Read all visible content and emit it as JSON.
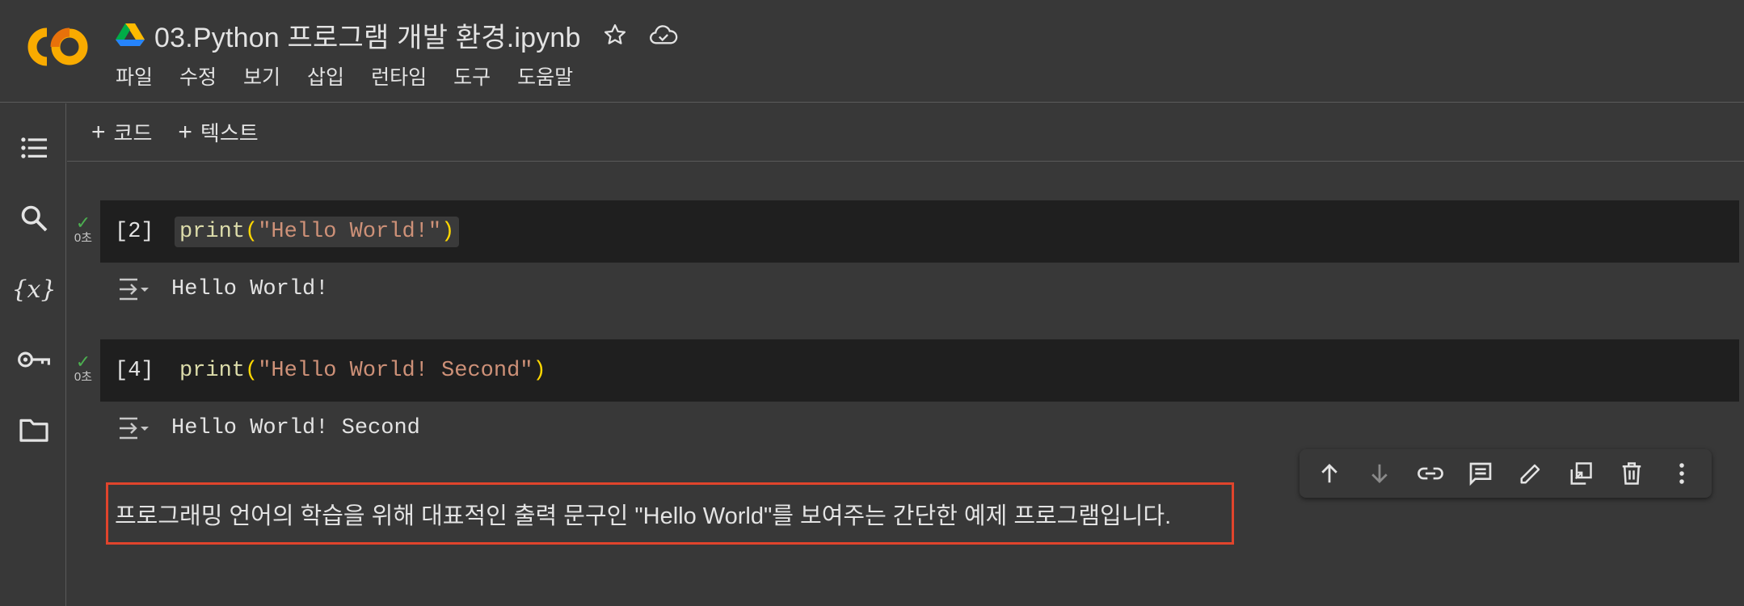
{
  "header": {
    "title": "03.Python 프로그램 개발 환경.ipynb",
    "menu": [
      "파일",
      "수정",
      "보기",
      "삽입",
      "런타임",
      "도구",
      "도움말"
    ]
  },
  "sidebar": {
    "icons": [
      "table-of-contents-icon",
      "search-icon",
      "variables-icon",
      "key-icon",
      "folder-icon"
    ],
    "variables_glyph": "{x}"
  },
  "toolbar": {
    "add_code_label": "코드",
    "add_text_label": "텍스트"
  },
  "cells": [
    {
      "status_time": "0초",
      "exec_count": "[2]",
      "code_fn": "print",
      "code_open": "(",
      "code_str": "\"Hello World!\"",
      "code_close": ")",
      "output": "Hello World!"
    },
    {
      "status_time": "0초",
      "exec_count": "[4]",
      "code_fn": "print",
      "code_open": "(",
      "code_str": "\"Hello World! Second\"",
      "code_close": ")",
      "output": "Hello World! Second"
    }
  ],
  "text_cell": {
    "content": "프로그래밍 언어의 학습을 위해 대표적인 출력 문구인 \"Hello World\"를 보여주는 간단한 예제 프로그램입니다."
  },
  "cell_toolbar": [
    "move-up-icon",
    "move-down-icon",
    "link-icon",
    "comment-icon",
    "edit-icon",
    "mirror-cell-icon",
    "delete-icon",
    "more-icon"
  ],
  "colors": {
    "background": "#383838",
    "code_bg": "#1f1f1f",
    "success": "#4caf50",
    "highlight_border": "#e0442c",
    "logo_orange": "#f9ab00",
    "logo_dark_orange": "#e8710a"
  }
}
